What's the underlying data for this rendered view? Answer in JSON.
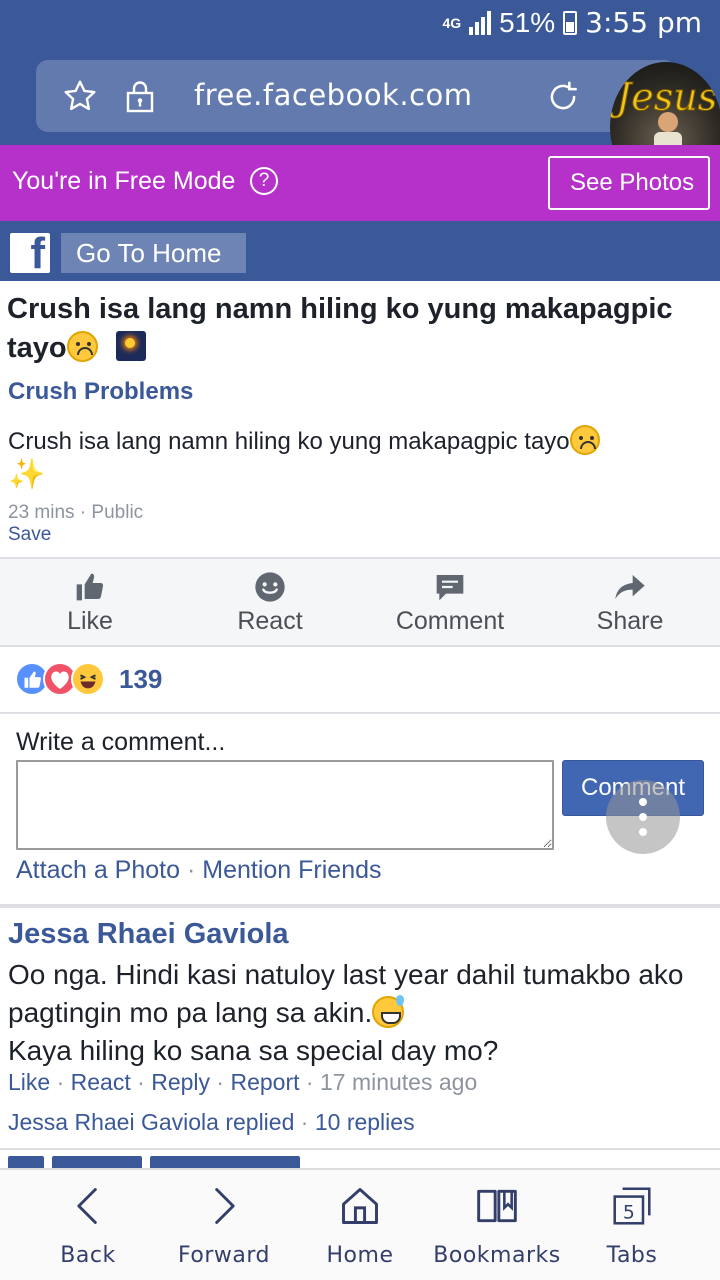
{
  "status": {
    "network": "4G",
    "battery": "51%",
    "time": "3:55 pm"
  },
  "browser": {
    "url": "free.facebook.com"
  },
  "free_mode": {
    "text": "You're in Free Mode",
    "help": "?",
    "see_photos_label": "See Photos"
  },
  "nav": {
    "logo": "f",
    "go_home_label": "Go To Home"
  },
  "post": {
    "title": "Crush isa lang namn hiling ko yung makapagpic tayo",
    "group": "Crush Problems",
    "body": "Crush isa lang namn hiling ko yung makapagpic tayo",
    "sparkle": "✨",
    "meta": "23 mins · Public",
    "save_label": "Save"
  },
  "actions": [
    {
      "label": "Like",
      "icon": "thumbs-up-icon"
    },
    {
      "label": "React",
      "icon": "smiley-icon"
    },
    {
      "label": "Comment",
      "icon": "speech-bubble-icon"
    },
    {
      "label": "Share",
      "icon": "share-arrow-icon"
    }
  ],
  "reactions": {
    "count": "139",
    "types": [
      "like",
      "love",
      "haha"
    ]
  },
  "composer": {
    "label": "Write a comment...",
    "value": "",
    "button": "Comment",
    "attach_photo": "Attach a Photo",
    "mention_friends": "Mention Friends",
    "separator": "·"
  },
  "comment": {
    "author": "Jessa Rhaei Gaviola",
    "text": "Oo nga. Hindi kasi natuloy last year dahil tumakbo ako pagtingin mo pa lang sa akin.",
    "text2": "Kaya hiling ko sana sa special day mo?",
    "like": "Like",
    "react": "React",
    "reply": "Reply",
    "report": "Report",
    "time": "17 minutes ago",
    "replied_by": "Jessa Rhaei Gaviola replied",
    "replies": "10 replies"
  },
  "bottom_nav": [
    {
      "label": "Back",
      "icon": "back-arrow-icon"
    },
    {
      "label": "Forward",
      "icon": "forward-arrow-icon"
    },
    {
      "label": "Home",
      "icon": "home-icon"
    },
    {
      "label": "Bookmarks",
      "icon": "bookmarks-icon"
    },
    {
      "label": "Tabs",
      "icon": "tabs-icon",
      "count": "5"
    }
  ],
  "colors": {
    "facebook_blue": "#3b5998",
    "free_mode_purple": "#b631c9",
    "link_blue": "#3b5998"
  }
}
